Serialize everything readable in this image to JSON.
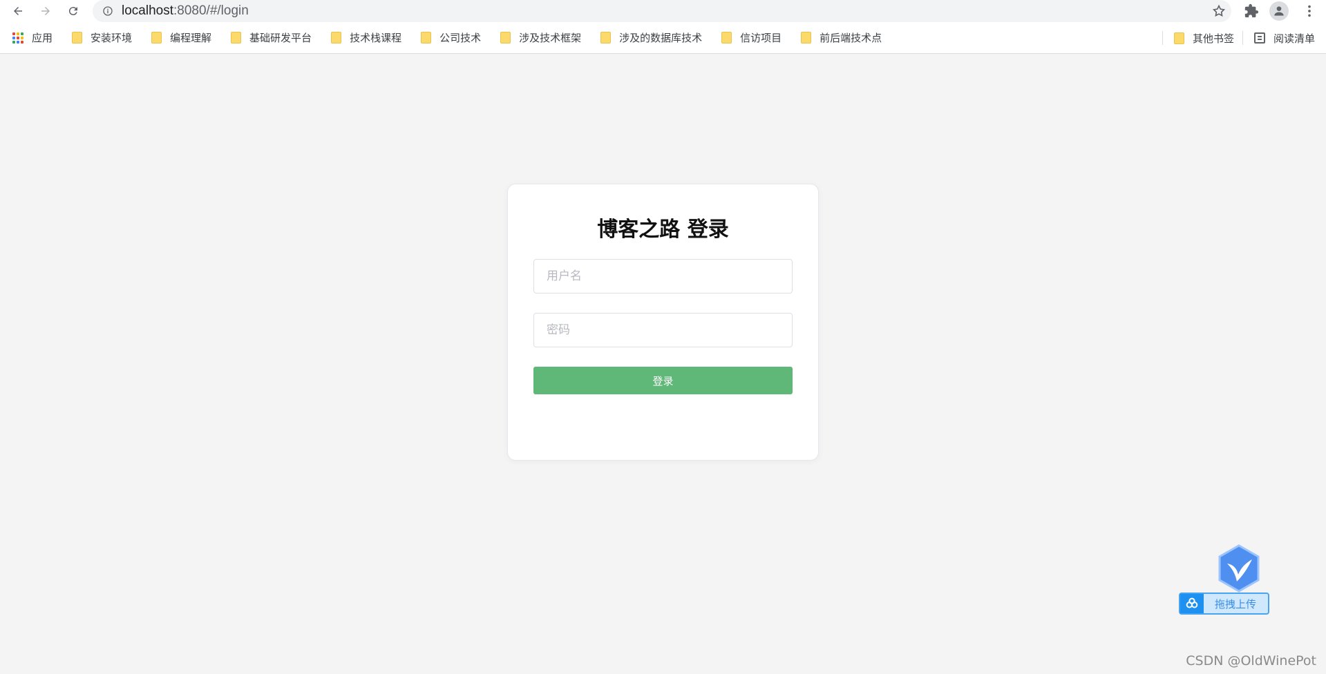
{
  "browser": {
    "url_host": "localhost",
    "url_rest": ":8080/#/login"
  },
  "bookmarks": {
    "apps_label": "应用",
    "items": [
      "安装环境",
      "编程理解",
      "基础研发平台",
      "技术栈课程",
      "公司技术",
      "涉及技术框架",
      "涉及的数据库技术",
      "信访项目",
      "前后端技术点"
    ],
    "other_label": "其他书签",
    "reading_list_label": "阅读清单"
  },
  "login": {
    "title": "博客之路 登录",
    "username_placeholder": "用户名",
    "password_placeholder": "密码",
    "submit_label": "登录"
  },
  "upload_widget": {
    "label": "拖拽上传"
  },
  "watermark": "CSDN @OldWinePot",
  "colors": {
    "button_green": "#5fb878",
    "background": "#f4f4f4",
    "folder_yellow": "#fbd96a"
  }
}
